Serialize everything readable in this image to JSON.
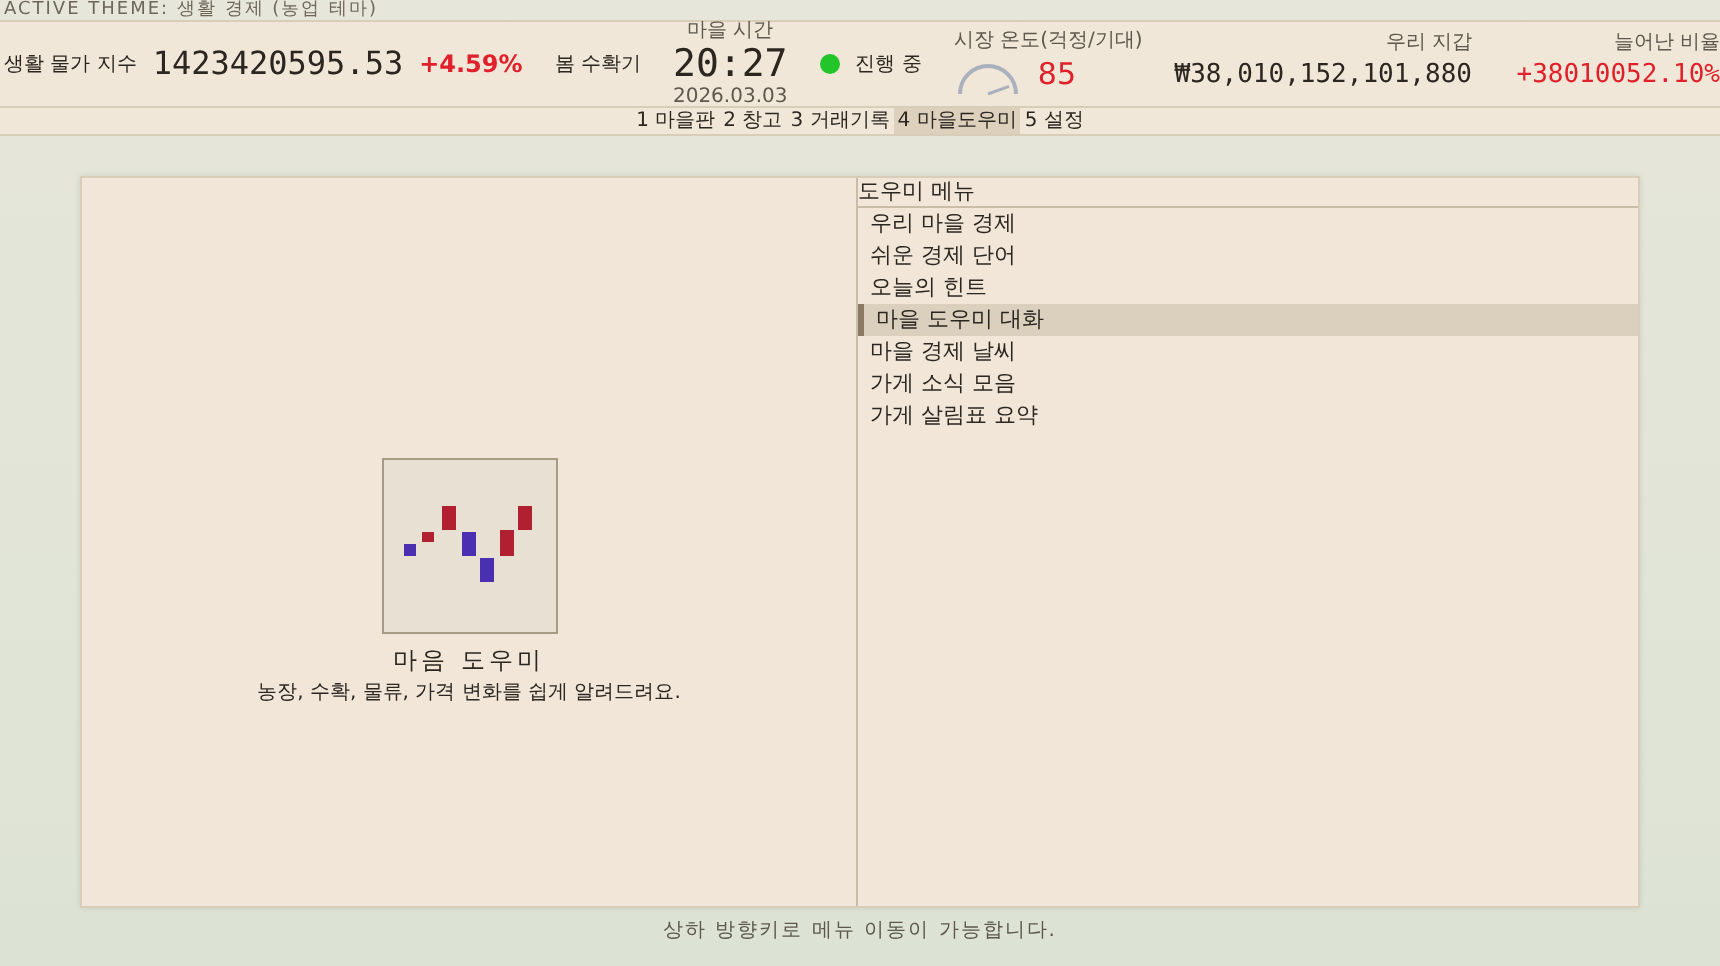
{
  "theme_label": "ACTIVE THEME: 생활 경제 (농업 테마)",
  "header": {
    "index_label": "생활 물가 지수",
    "index_value": "1423420595.53",
    "index_change": "+4.59%",
    "season": "봄 수확기",
    "time_label": "마을 시간",
    "time": "20:27",
    "date": "2026.03.03",
    "status_on": true,
    "status": "진행 중",
    "gauge_label": "시장 온도(걱정/기대)",
    "gauge_value": "85",
    "wallet_label": "우리 지갑",
    "wallet": "₩38,010,152,101,880",
    "ratio_label": "늘어난 비율",
    "ratio": "+38010052.10%"
  },
  "tabs": [
    {
      "label": "1 마을판",
      "selected": false
    },
    {
      "label": "2 창고",
      "selected": false
    },
    {
      "label": "3 거래기록",
      "selected": false
    },
    {
      "label": "4 마을도우미",
      "selected": true
    },
    {
      "label": "5 설정",
      "selected": false
    }
  ],
  "helper": {
    "name": "마음 도우미",
    "description": "농장, 수확, 물류, 가격 변화를 쉽게 알려드려요."
  },
  "menu": {
    "title": "도우미 메뉴",
    "items": [
      {
        "label": "우리 마을 경제",
        "selected": false
      },
      {
        "label": "쉬운 경제 단어",
        "selected": false
      },
      {
        "label": "오늘의 힌트",
        "selected": false
      },
      {
        "label": "마을 도우미 대화",
        "selected": true
      },
      {
        "label": "마을 경제 날씨",
        "selected": false
      },
      {
        "label": "가게 소식 모음",
        "selected": false
      },
      {
        "label": "가게 살림표 요약",
        "selected": false
      }
    ]
  },
  "footer_hint": "상하 방향키로 메뉴 이동이 가능합니다."
}
